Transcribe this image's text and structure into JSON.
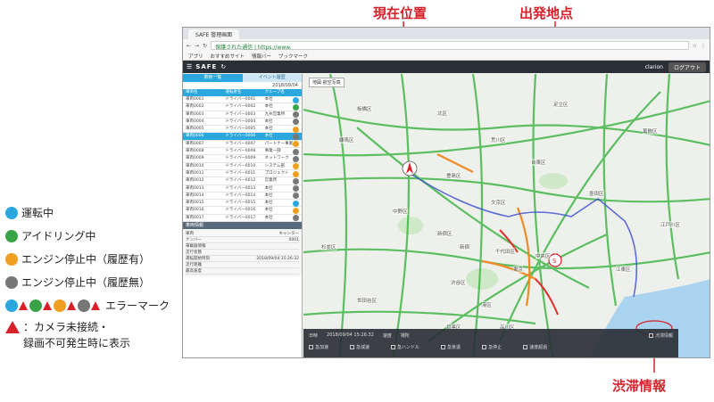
{
  "annotations": {
    "current_position": "現在位置",
    "start_point": "出発地点",
    "traffic_info": "渋滞情報"
  },
  "legend": {
    "driving": "運転中",
    "idling": "アイドリング中",
    "engine_stopped_history": "エンジン停止中（履歴有）",
    "engine_stopped_no_history": "エンジン停止中（履歴無）",
    "error_mark": "エラーマーク",
    "camera_note_line1": "：カメラ未接続・",
    "camera_note_line2": "録画不可発生時に表示"
  },
  "browser": {
    "tab_title": "SAFE 管理画面",
    "url": "保護された通信 | https://www.",
    "bookmarks": [
      "アプリ",
      "おすすめサイト",
      "情報バー",
      "ブックマーク"
    ]
  },
  "app": {
    "logo": "SAFE",
    "brand": "clarion",
    "logout": "ログアウト"
  },
  "panel": {
    "tabs": [
      "車両一覧",
      "イベント履歴"
    ],
    "date": "2018/09/04",
    "headers": [
      "車両名",
      "運転者名",
      "グループ名"
    ],
    "rows": [
      {
        "name": "車両0001",
        "driver": "ドライバー0001",
        "group": "本社"
      },
      {
        "name": "車両0002",
        "driver": "ドライバー0002",
        "group": "本社"
      },
      {
        "name": "車両0003",
        "driver": "ドライバー0003",
        "group": "九州営業所"
      },
      {
        "name": "車両0004",
        "driver": "ドライバー0004",
        "group": "本社"
      },
      {
        "name": "車両0005",
        "driver": "ドライバー0005",
        "group": "本社"
      },
      {
        "name": "車両0006",
        "driver": "ドライバー0006",
        "group": "本社"
      },
      {
        "name": "車両0007",
        "driver": "ドライバー0007",
        "group": "パートナー事業"
      },
      {
        "name": "車両0008",
        "driver": "ドライバー0008",
        "group": "事業一部"
      },
      {
        "name": "車両0009",
        "driver": "ドライバー0009",
        "group": "ネットワーク"
      },
      {
        "name": "車両0010",
        "driver": "ドライバー0010",
        "group": "システム部"
      },
      {
        "name": "車両0011",
        "driver": "ドライバー0011",
        "group": "プロジェクト"
      },
      {
        "name": "車両0012",
        "driver": "ドライバー0012",
        "group": "営業所"
      },
      {
        "name": "車両0013",
        "driver": "ドライバー0013",
        "group": "本社"
      },
      {
        "name": "車両0014",
        "driver": "ドライバー0014",
        "group": "本社"
      },
      {
        "name": "車両0015",
        "driver": "ドライバー0015",
        "group": "本社"
      },
      {
        "name": "車両0016",
        "driver": "ドライバー0016",
        "group": "本社"
      },
      {
        "name": "車両0017",
        "driver": "ドライバー0017",
        "group": "本社"
      }
    ],
    "detail": {
      "header": "車両情報",
      "lines": [
        {
          "k": "車両",
          "v": "キャンター"
        },
        {
          "k": "ナンバー",
          "v": "0001"
        },
        {
          "k": "車載器情報",
          "v": ""
        },
        {
          "k": "走行状態",
          "v": ""
        },
        {
          "k": "運転開始時刻",
          "v": "2018/09/04 15:26:32"
        },
        {
          "k": "走行距離",
          "v": ""
        },
        {
          "k": "最高速度",
          "v": ""
        }
      ]
    }
  },
  "map": {
    "tag": "地図 航空写真",
    "bar_row1": [
      "日時",
      "2018/09/04 15:26:32",
      "速度",
      "場所",
      "渋滞情報"
    ],
    "bar_row2": [
      "急加速",
      "急減速",
      "急ハンドル",
      "急後退",
      "急停止",
      "速度超過"
    ],
    "labels": [
      "新宿区",
      "渋谷区",
      "港区",
      "千代田区",
      "台東区",
      "江東区",
      "墨田区",
      "練馬区",
      "板橋区",
      "北区",
      "荒川区",
      "足立区",
      "葛飾区",
      "江戸川区",
      "品川区",
      "目黒区",
      "世田谷区",
      "中野区",
      "杉並区",
      "豊島区",
      "文京区",
      "中央区",
      "新宿",
      "東京"
    ]
  }
}
